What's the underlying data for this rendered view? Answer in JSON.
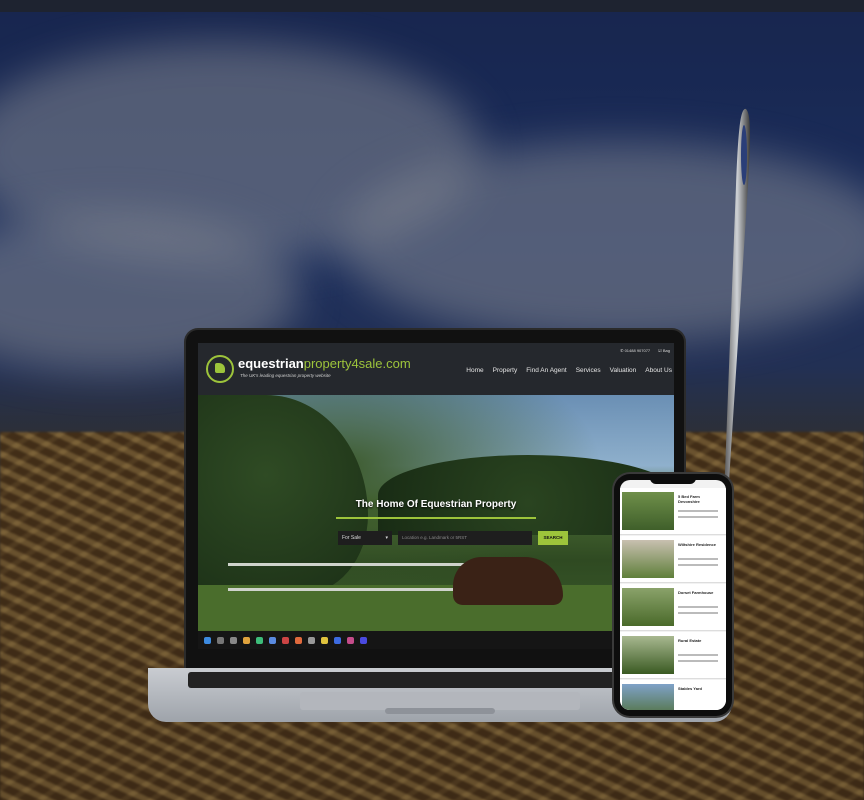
{
  "site": {
    "brand_main": "equestrian",
    "brand_accent": "property4sale.com",
    "tagline": "The UK's leading equestrian property website",
    "phone": "01488 907077",
    "bag_label": "Bag",
    "nav": [
      "Home",
      "Property",
      "Find An Agent",
      "Services",
      "Valuation",
      "About Us"
    ],
    "hero_title": "The Home Of Equestrian Property",
    "search": {
      "selected": "For Sale",
      "placeholder": "Location e.g. Landmark or 5RST",
      "button": "SEARCH"
    }
  },
  "colors": {
    "accent": "#9dc43b",
    "header_bg": "#25282d"
  },
  "phone_cards": [
    {
      "title": "5 Bed Farm Devonshire"
    },
    {
      "title": "Wiltshire Residence"
    },
    {
      "title": "Dorset Farmhouse"
    },
    {
      "title": "Rural Estate"
    },
    {
      "title": "Stables Yard"
    }
  ]
}
